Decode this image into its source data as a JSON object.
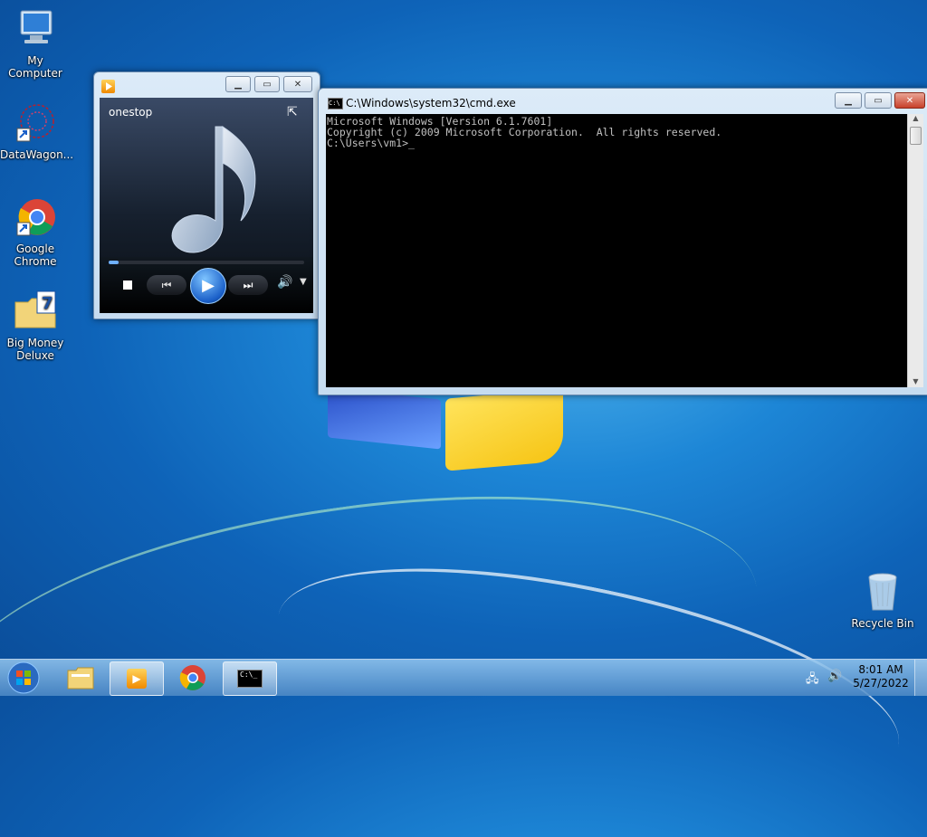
{
  "desktop": {
    "icons": [
      {
        "label": "My Computer"
      },
      {
        "label": "DataWagon..."
      },
      {
        "label": "Google Chrome"
      },
      {
        "label": "Big Money Deluxe"
      },
      {
        "label": "Recycle Bin"
      }
    ]
  },
  "media_player": {
    "track_title": "onestop",
    "progress": 0.05,
    "controls": {
      "stop": "stop",
      "prev": "previous",
      "play": "play",
      "next": "next",
      "volume": "volume"
    }
  },
  "cmd": {
    "title": "C:\\Windows\\system32\\cmd.exe",
    "lines": [
      "Microsoft Windows [Version 6.1.7601]",
      "Copyright (c) 2009 Microsoft Corporation.  All rights reserved.",
      "",
      "C:\\Users\\vm1>_"
    ]
  },
  "taskbar": {
    "clock_time": "8:01 AM",
    "clock_date": "5/27/2022",
    "items": [
      "start",
      "windows-explorer",
      "windows-media-player",
      "google-chrome",
      "command-prompt"
    ]
  }
}
